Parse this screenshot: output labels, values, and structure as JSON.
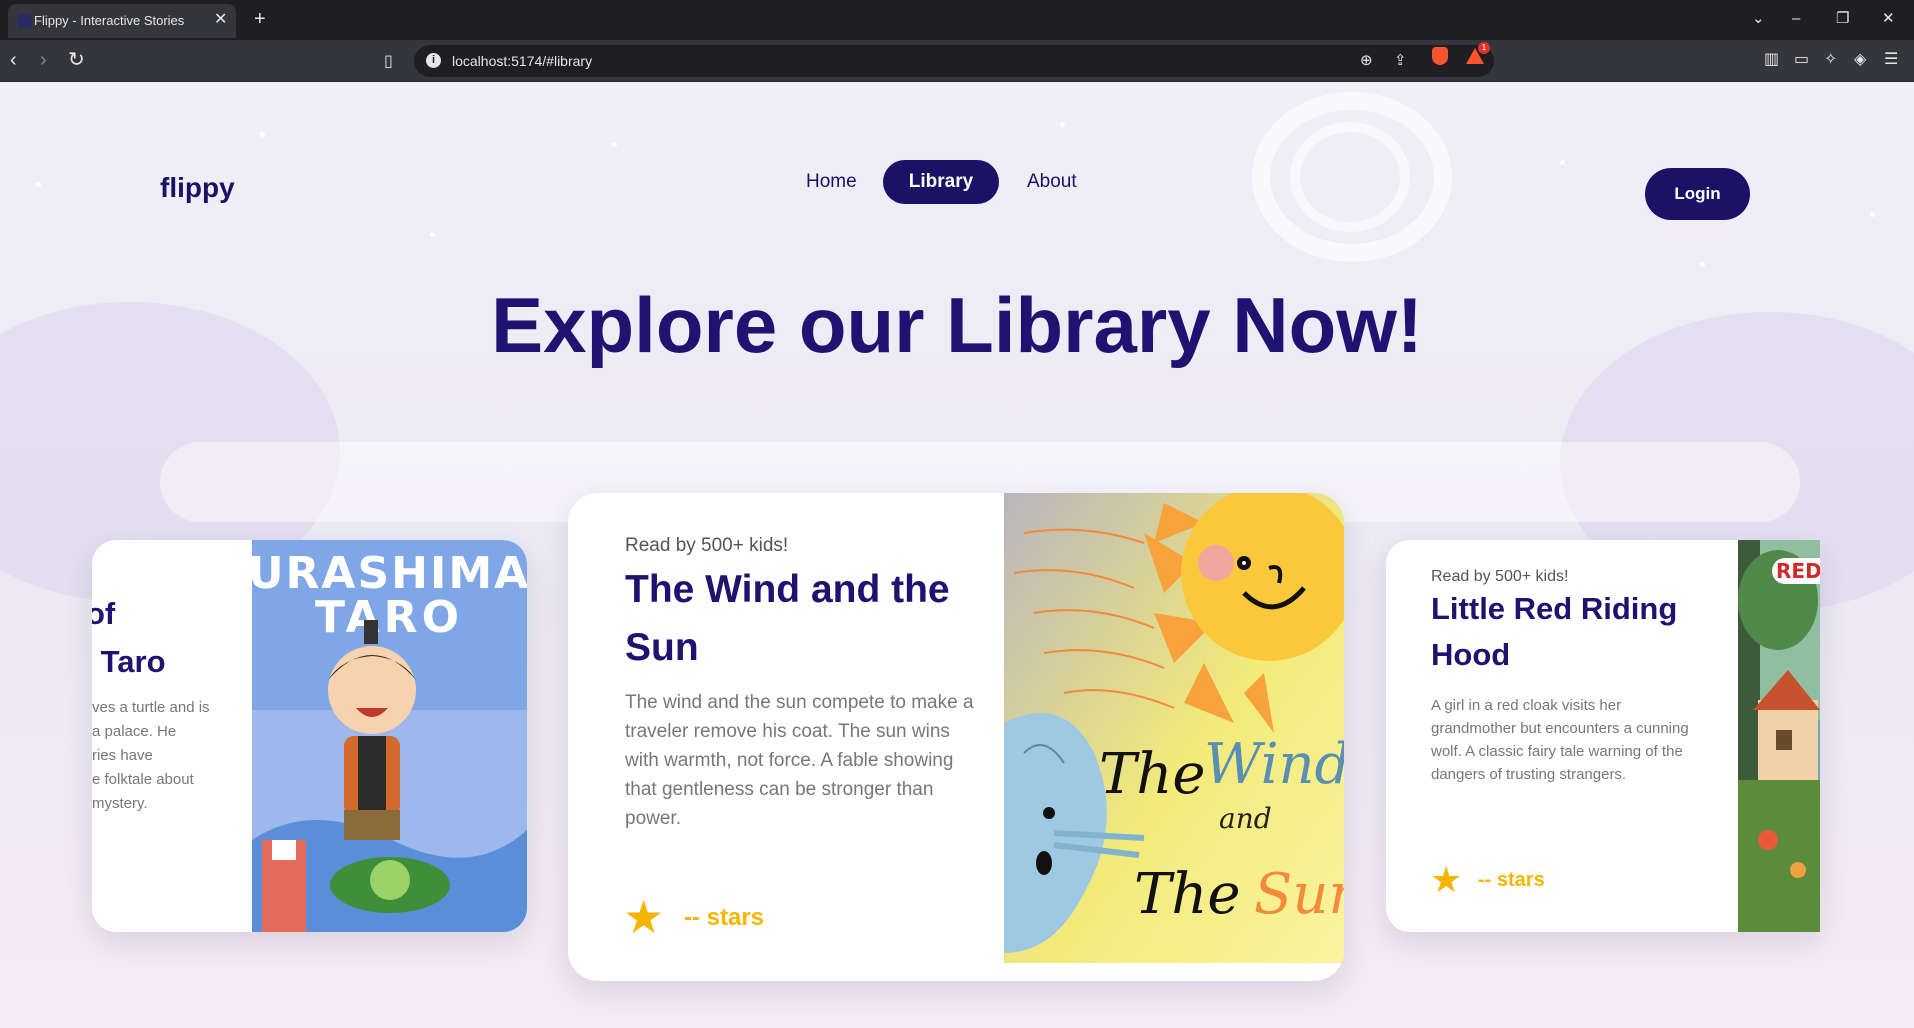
{
  "browser": {
    "tab_title": "Flippy - Interactive Stories",
    "url": "localhost:5174/#library",
    "notification_count": "1"
  },
  "nav": {
    "logo": "flippy",
    "links": [
      "Home",
      "Library",
      "About"
    ],
    "active": "Library",
    "login": "Login"
  },
  "hero": {
    "title": "Explore our Library Now!"
  },
  "cards": [
    {
      "title_fragment_1": "of",
      "title_fragment_2": "Taro",
      "desc_lines": [
        "ves a turtle and is",
        "a palace. He",
        "ries have",
        "e folktale about",
        "mystery."
      ],
      "cover_text": "URASHIMA TARO"
    },
    {
      "reads": "Read by 500+ kids!",
      "title": "The Wind and the Sun",
      "desc": "The wind and the sun compete to make a traveler remove his coat. The sun wins with warmth, not force. A fable showing that gentleness can be stronger than power.",
      "rating": "-- stars",
      "cover_text_1": "The Wind",
      "cover_text_2": "and",
      "cover_text_3": "The Sun"
    },
    {
      "reads": "Read by 500+ kids!",
      "title": "Little Red Riding Hood",
      "desc": "A girl in a red cloak visits her grandmother but encounters a cunning wolf. A classic fairy tale warning of the dangers of trusting strangers.",
      "rating": "-- stars",
      "cover_text": "RED"
    }
  ],
  "colors": {
    "brand": "#1b1268",
    "star": "#f7b500"
  },
  "icons": [
    "star-icon",
    "bookmark-icon",
    "info-icon",
    "zoom-icon",
    "share-icon",
    "brave-shield-icon"
  ]
}
